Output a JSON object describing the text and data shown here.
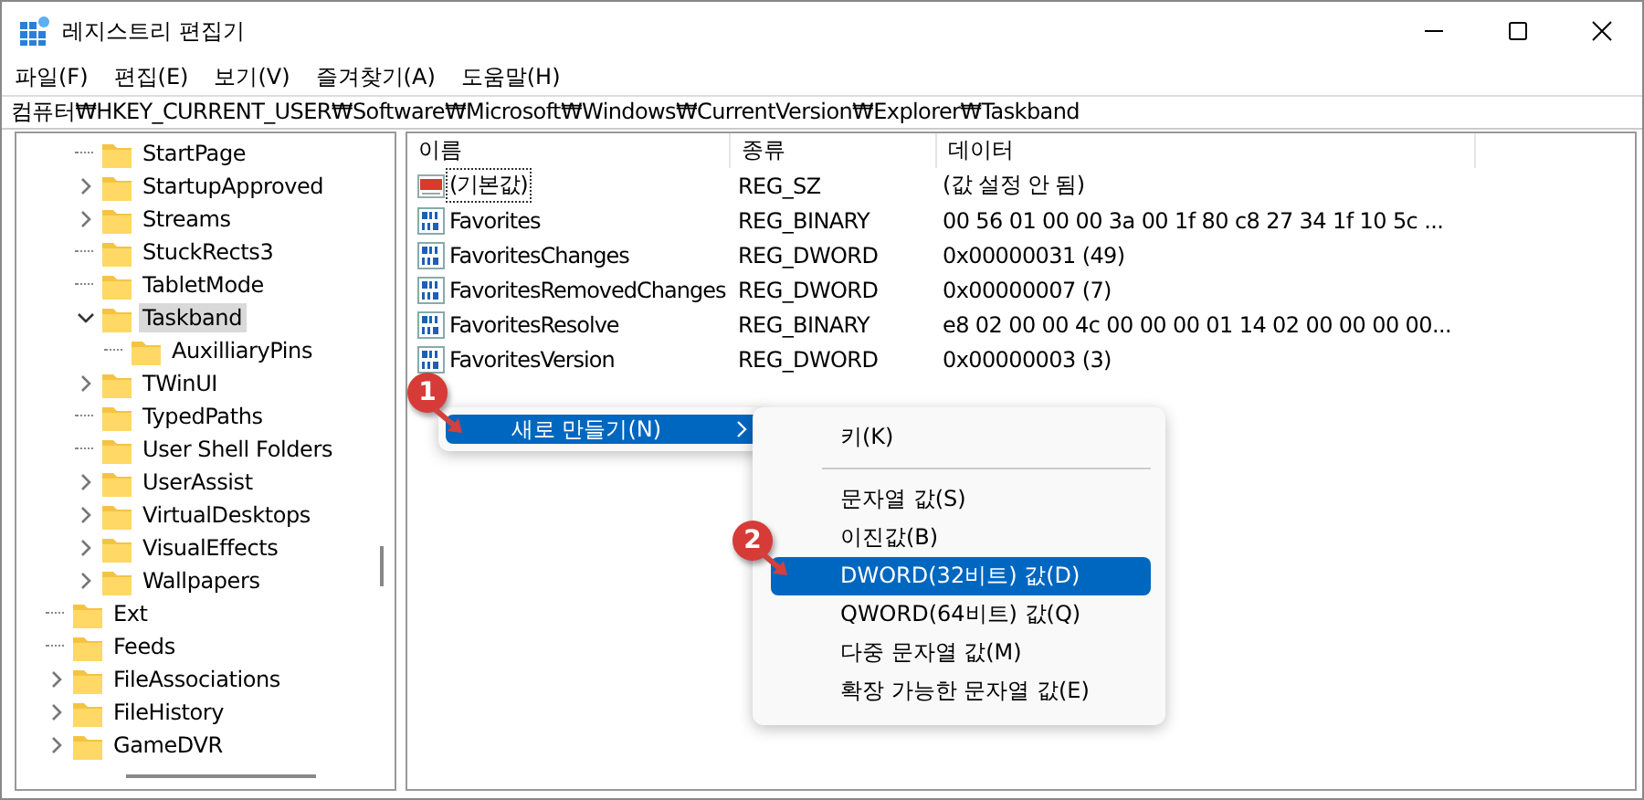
{
  "window": {
    "title": "레지스트리 편집기"
  },
  "menu_bar": [
    "파일(F)",
    "편집(E)",
    "보기(V)",
    "즐겨찾기(A)",
    "도움말(H)"
  ],
  "address": "컴퓨터₩HKEY_CURRENT_USER₩Software₩Microsoft₩Windows₩CurrentVersion₩Explorer₩Taskband",
  "tree": [
    {
      "children": [
        {
          "label": "StartPage",
          "has_children": false,
          "expanded": false,
          "selected": false
        },
        {
          "label": "StartupApproved",
          "has_children": true,
          "expanded": false,
          "selected": false
        },
        {
          "label": "Streams",
          "has_children": true,
          "expanded": false,
          "selected": false
        },
        {
          "label": "StuckRects3",
          "has_children": false,
          "expanded": false,
          "selected": false
        },
        {
          "label": "TabletMode",
          "has_children": false,
          "expanded": false,
          "selected": false
        },
        {
          "label": "Taskband",
          "has_children": true,
          "expanded": true,
          "selected": true,
          "children": [
            {
              "label": "AuxilliaryPins",
              "has_children": false,
              "expanded": false,
              "selected": false
            }
          ]
        },
        {
          "label": "TWinUI",
          "has_children": true,
          "expanded": false,
          "selected": false
        },
        {
          "label": "TypedPaths",
          "has_children": false,
          "expanded": false,
          "selected": false
        },
        {
          "label": "User Shell Folders",
          "has_children": false,
          "expanded": false,
          "selected": false
        },
        {
          "label": "UserAssist",
          "has_children": true,
          "expanded": false,
          "selected": false
        },
        {
          "label": "VirtualDesktops",
          "has_children": true,
          "expanded": false,
          "selected": false
        },
        {
          "label": "VisualEffects",
          "has_children": true,
          "expanded": false,
          "selected": false
        },
        {
          "label": "Wallpapers",
          "has_children": true,
          "expanded": false,
          "selected": false
        }
      ]
    },
    {
      "label": "Ext",
      "has_children": false,
      "expanded": false,
      "selected": false
    },
    {
      "label": "Feeds",
      "has_children": false,
      "expanded": false,
      "selected": false
    },
    {
      "label": "FileAssociations",
      "has_children": true,
      "expanded": false,
      "selected": false
    },
    {
      "label": "FileHistory",
      "has_children": true,
      "expanded": false,
      "selected": false
    },
    {
      "label": "GameDVR",
      "has_children": true,
      "expanded": false,
      "selected": false
    }
  ],
  "table": {
    "columns": [
      "이름",
      "종류",
      "데이터"
    ],
    "rows": [
      {
        "kind": "string",
        "name": "(기본값)",
        "type": "REG_SZ",
        "data": "(값 설정 안 됨)",
        "focused": true
      },
      {
        "kind": "binary",
        "name": "Favorites",
        "type": "REG_BINARY",
        "data": "00 56 01 00 00 3a 00 1f 80 c8 27 34 1f 10 5c ...",
        "focused": false
      },
      {
        "kind": "binary",
        "name": "FavoritesChanges",
        "type": "REG_DWORD",
        "data": "0x00000031 (49)",
        "focused": false
      },
      {
        "kind": "binary",
        "name": "FavoritesRemovedChanges",
        "type": "REG_DWORD",
        "data": "0x00000007 (7)",
        "focused": false
      },
      {
        "kind": "binary",
        "name": "FavoritesResolve",
        "type": "REG_BINARY",
        "data": "e8 02 00 00 4c 00 00 00 01 14 02 00 00 00 00...",
        "focused": false
      },
      {
        "kind": "binary",
        "name": "FavoritesVersion",
        "type": "REG_DWORD",
        "data": "0x00000003 (3)",
        "focused": false
      }
    ]
  },
  "context_menu": {
    "items": [
      {
        "label": "새로 만들기(N)",
        "submenu": true,
        "selected": true
      }
    ]
  },
  "submenu": {
    "items": [
      {
        "kind": "item",
        "label": "키(K)",
        "selected": false
      },
      {
        "kind": "separator"
      },
      {
        "kind": "item",
        "label": "문자열 값(S)",
        "selected": false
      },
      {
        "kind": "item",
        "label": "이진값(B)",
        "selected": false
      },
      {
        "kind": "item",
        "label": "DWORD(32비트) 값(D)",
        "selected": true
      },
      {
        "kind": "item",
        "label": "QWORD(64비트) 값(Q)",
        "selected": false
      },
      {
        "kind": "item",
        "label": "다중 문자열 값(M)",
        "selected": false
      },
      {
        "kind": "item",
        "label": "확장 가능한 문자열 값(E)",
        "selected": false
      }
    ]
  },
  "annotations": [
    {
      "label": "1"
    },
    {
      "label": "2"
    }
  ]
}
